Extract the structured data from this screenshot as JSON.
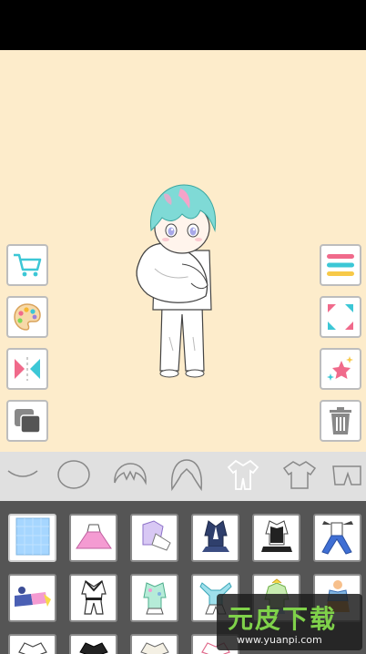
{
  "app": {
    "side_left": [
      {
        "icon": "cart-icon",
        "action": "shop"
      },
      {
        "icon": "palette-icon",
        "action": "color"
      },
      {
        "icon": "flip-icon",
        "action": "flip"
      },
      {
        "icon": "layers-icon",
        "action": "layers"
      }
    ],
    "side_right": [
      {
        "icon": "menu-icon",
        "action": "menu"
      },
      {
        "icon": "expand-icon",
        "action": "fullscreen"
      },
      {
        "icon": "star-sparkle-icon",
        "action": "effects"
      },
      {
        "icon": "trash-icon",
        "action": "delete"
      }
    ],
    "categories": [
      {
        "icon": "mouth-icon"
      },
      {
        "icon": "face-outline-icon"
      },
      {
        "icon": "bangs-icon"
      },
      {
        "icon": "hair-icon"
      },
      {
        "icon": "outfit-icon",
        "selected": true
      },
      {
        "icon": "shirt-icon"
      },
      {
        "icon": "pants-icon"
      }
    ],
    "colors": {
      "stage_bg": "#fdeccb",
      "hair": "#7fdad6",
      "hair_highlight": "#f5a3c9",
      "accent_cyan": "#3cc7d6",
      "accent_pink": "#f06a8b"
    }
  },
  "watermark": {
    "title": "元皮下载",
    "url": "www.yuanpi.com"
  }
}
